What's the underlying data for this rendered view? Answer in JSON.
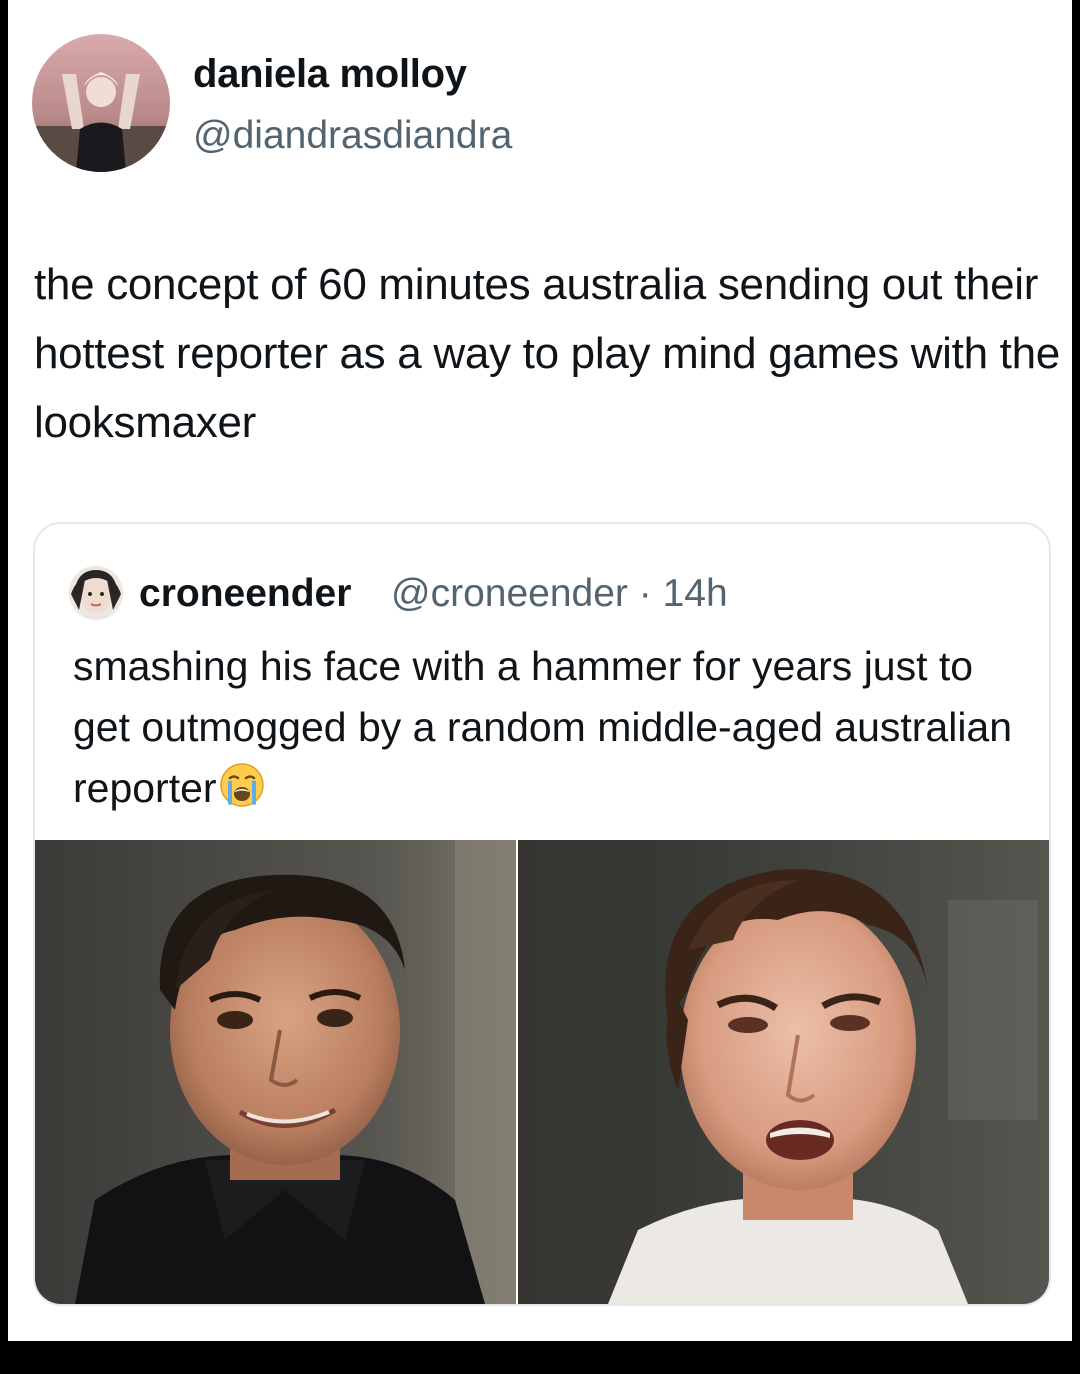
{
  "tweet": {
    "author": {
      "display_name": "daniela molloy",
      "handle": "@diandrasdiandra",
      "avatar": "avatar-photo"
    },
    "text": "the concept of 60 minutes australia sending out their hottest reporter as a way to play mind games with the looksmaxer"
  },
  "quoted_tweet": {
    "author": {
      "display_name": "croneender",
      "handle": "@croneender",
      "separator": "·",
      "time": "14h",
      "avatar": "avatar-photo"
    },
    "text": "smashing his face with a hammer for years just to get outmogged by a random middle-aged australian reporter",
    "emoji": "loudly-crying-face-emoji",
    "media": [
      {
        "name": "reporter-photo"
      },
      {
        "name": "interviewee-photo"
      }
    ]
  },
  "colors": {
    "text_primary": "#0f1419",
    "text_secondary": "#536471",
    "border": "#e6e9ec",
    "frame": "#000000"
  }
}
